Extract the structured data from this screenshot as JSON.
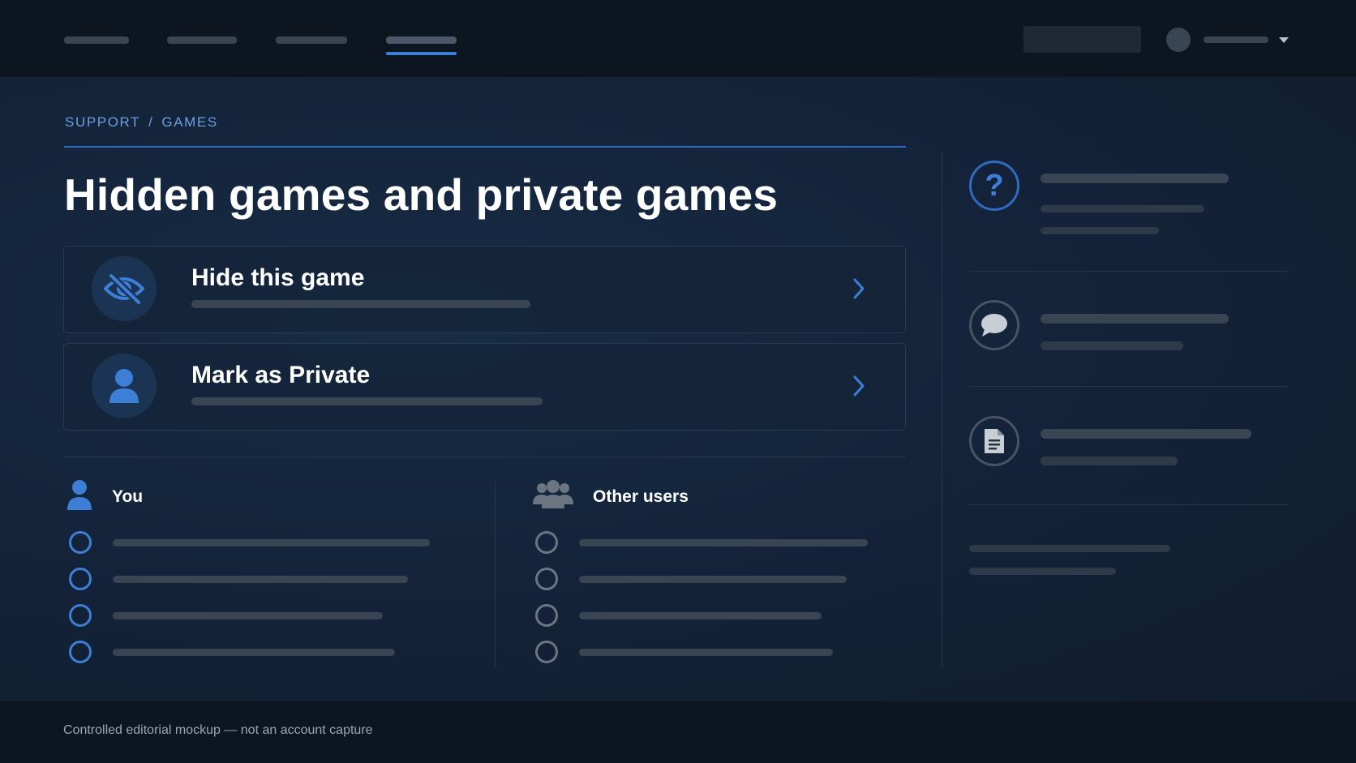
{
  "breadcrumb": {
    "first": "SUPPORT",
    "separator": "/",
    "second": "GAMES"
  },
  "page": {
    "title": "Hidden games and private games"
  },
  "options": [
    {
      "label": "Hide this game",
      "icon": "eye-slash-icon"
    },
    {
      "label": "Mark as Private",
      "icon": "user-icon"
    }
  ],
  "columns": {
    "you": {
      "title": "You",
      "icon": "user-icon"
    },
    "others": {
      "title": "Other users",
      "icon": "users-group-icon"
    }
  },
  "sidebar": {
    "icons": [
      "question-icon",
      "chat-bubble-icon",
      "document-icon"
    ]
  },
  "footer": {
    "note": "Controlled editorial mockup — not an account capture"
  },
  "colors": {
    "accent": "#3d7fd6",
    "background": "#142237",
    "bar": "#0d1520"
  }
}
